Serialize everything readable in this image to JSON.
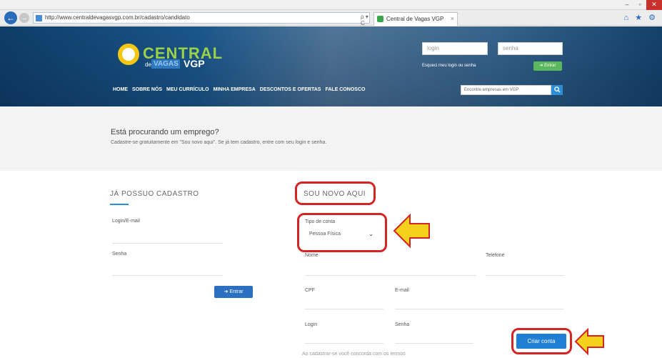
{
  "browser": {
    "url": "http://www.centraldevagasvgp.com.br/cadastro/candidato",
    "tab_title": "Central de Vagas VGP",
    "address_tools": "ρ ▾ C",
    "back_glyph": "←",
    "forward_glyph": "→",
    "tab_close": "×",
    "window_minimize": "–",
    "window_maximize": "▫",
    "window_close": "✕",
    "toolbar_glyphs": "⌂ ★ ⚙"
  },
  "site": {
    "logo": {
      "central": "CENTRAL",
      "de": "de",
      "vagas": "VAGAS",
      "vgp": "VGP"
    },
    "login_placeholder": "login",
    "password_placeholder": "senha",
    "forgot_text": "Esqueci meu login ou senha",
    "enter_top": "➜ Entrar",
    "menu": [
      "HOME",
      "SOBRE NÓS",
      "MEU CURRÍCULO",
      "MINHA EMPRESA",
      "DESCONTOS E OFERTAS",
      "FALE CONOSCO"
    ],
    "search_placeholder": "Encontre empresas em VGP",
    "search_icon": "search-icon"
  },
  "intro": {
    "title": "Está procurando um emprego?",
    "subtitle": "Cadastre-se gratuitamente em \"Sou novo aqui\". Se já tem cadastro, entre com seu login e senha."
  },
  "login_form": {
    "title": "JÁ POSSUO CADASTRO",
    "login_label": "Login/E-mail",
    "password_label": "Senha",
    "enter_button": "➜ Entrar"
  },
  "signup_form": {
    "title": "SOU NOVO AQUI",
    "account_type_label": "Tipo de conta",
    "account_type_value": "Pessoa Física",
    "name_label": "Nome",
    "phone_label": "Telefone",
    "cpf_label": "CPF",
    "email_label": "E-mail",
    "login_label": "Login",
    "password_label": "Senha",
    "create_button": "Criar conta",
    "bottom_text": "Ao cadastrar-se você concorda com os termos"
  },
  "colors": {
    "highlight": "#d42424",
    "arrow_fill": "#f4d21c",
    "brand_blue": "#1f7fd4"
  }
}
